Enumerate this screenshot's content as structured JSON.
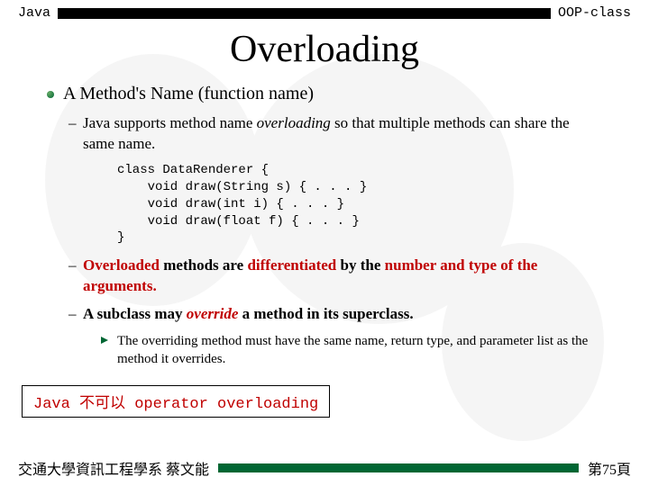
{
  "header": {
    "left": "Java",
    "right": "OOP-class"
  },
  "title": "Overloading",
  "bullets": {
    "item1": "A Method's Name (function name)",
    "item2_pre": "Java supports method name ",
    "item2_em": "overloading",
    "item2_post": " so that multiple methods can share the same name.",
    "code": "class DataRenderer {\n    void draw(String s) { . . . }\n    void draw(int i) { . . . }\n    void draw(float f) { . . . }\n}",
    "item3_parts": {
      "a": "Overloaded",
      "b": " methods are ",
      "c": "differentiated",
      "d": " by the ",
      "e": "number and type of the arguments",
      "f": "."
    },
    "item4_pre": "A subclass may ",
    "item4_em": "override",
    "item4_post": " a method in its superclass.",
    "item5": "The overriding method must have the same name, return type, and parameter list as the method it overrides."
  },
  "note": "Java 不可以 operator overloading",
  "footer": {
    "left": "交通大學資訊工程學系 蔡文能",
    "right": "第75頁"
  }
}
